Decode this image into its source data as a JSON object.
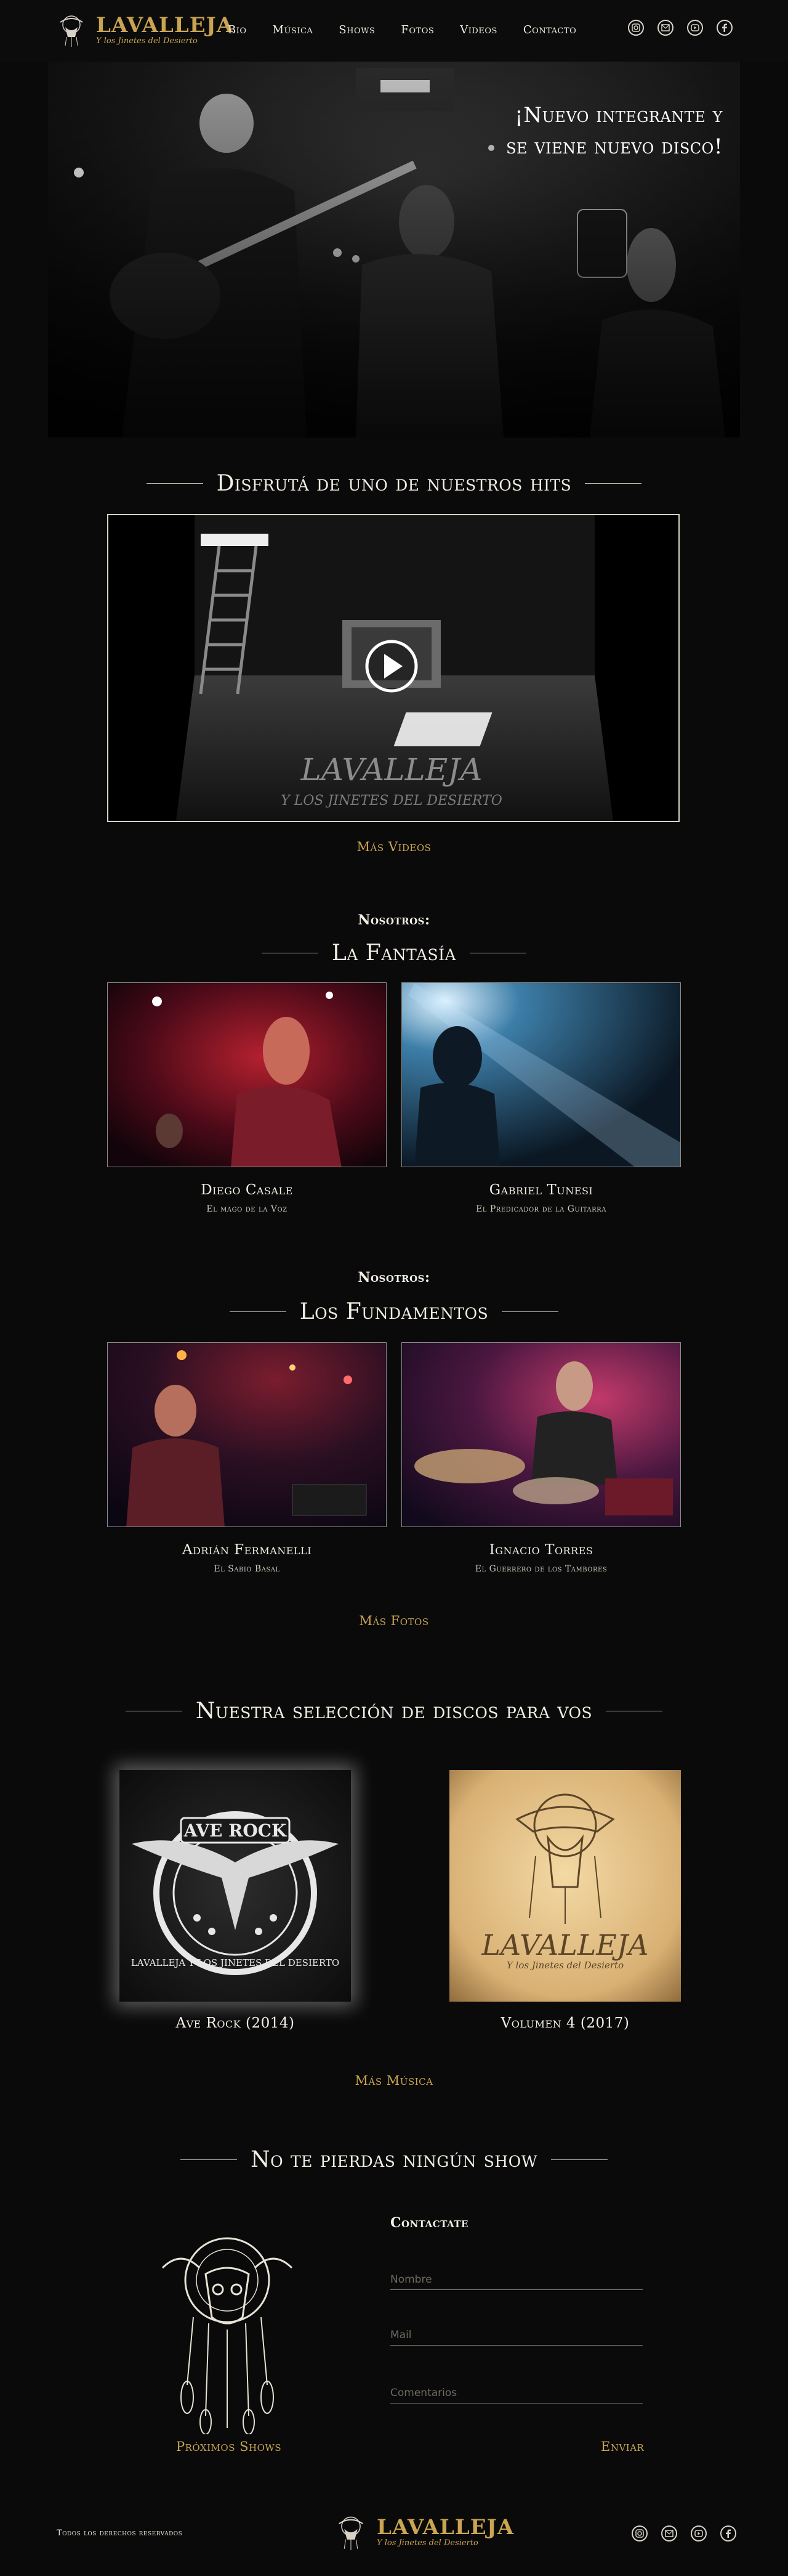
{
  "brand": {
    "name": "LAVALLEJA",
    "tagline": "Y los Jinetes del Desierto"
  },
  "nav": {
    "items": [
      "Bio",
      "Música",
      "Shows",
      "Fotos",
      "Videos",
      "Contacto"
    ]
  },
  "social": [
    "instagram-icon",
    "email-icon",
    "youtube-icon",
    "facebook-icon"
  ],
  "hero": {
    "line1": "¡Nuevo integrante y",
    "line2": "se viene nuevo disco!"
  },
  "hits": {
    "title": "Disfrutá de uno de nuestros hits",
    "video_logo": "LAVALLEJA",
    "video_logo_sub": "Y LOS JINETES DEL DESIERTO",
    "more": "Más Videos"
  },
  "fantasia": {
    "kicker": "Nosotros:",
    "title": "La Fantasía",
    "members": [
      {
        "name": "Diego Casale",
        "role": "El mago de la Voz"
      },
      {
        "name": "Gabriel Tunesi",
        "role": "El Predicador de la Guitarra"
      }
    ]
  },
  "fundamentos": {
    "kicker": "Nosotros:",
    "title": "Los Fundamentos",
    "members": [
      {
        "name": "Adrián Fermanelli",
        "role": "El Sabio Basal"
      },
      {
        "name": "Ignacio Torres",
        "role": "El Guerrero de los Tambores"
      }
    ],
    "more": "Más Fotos"
  },
  "discos": {
    "title": "Nuestra selección de discos para vos",
    "albums": [
      {
        "title": "Ave Rock (2014)",
        "cover_text": "AVE ROCK",
        "cover_ring": "LAVALLEJA Y LOS JINETES DEL DESIERTO"
      },
      {
        "title": "Volumen 4 (2017)",
        "cover_text": "LAVALLEJA",
        "cover_sub": "Y los Jinetes del Desierto"
      }
    ],
    "more": "Más Música"
  },
  "shows": {
    "title": "No te pierdas ningún show",
    "more": "Próximos Shows"
  },
  "contact": {
    "heading": "Contactate",
    "name_placeholder": "Nombre",
    "email_placeholder": "Mail",
    "comments_placeholder": "Comentarios",
    "submit": "Enviar"
  },
  "footer": {
    "copyright": "Todos los derechos reservados"
  },
  "colors": {
    "accent": "#c9a451",
    "background": "#0a0a0a"
  }
}
